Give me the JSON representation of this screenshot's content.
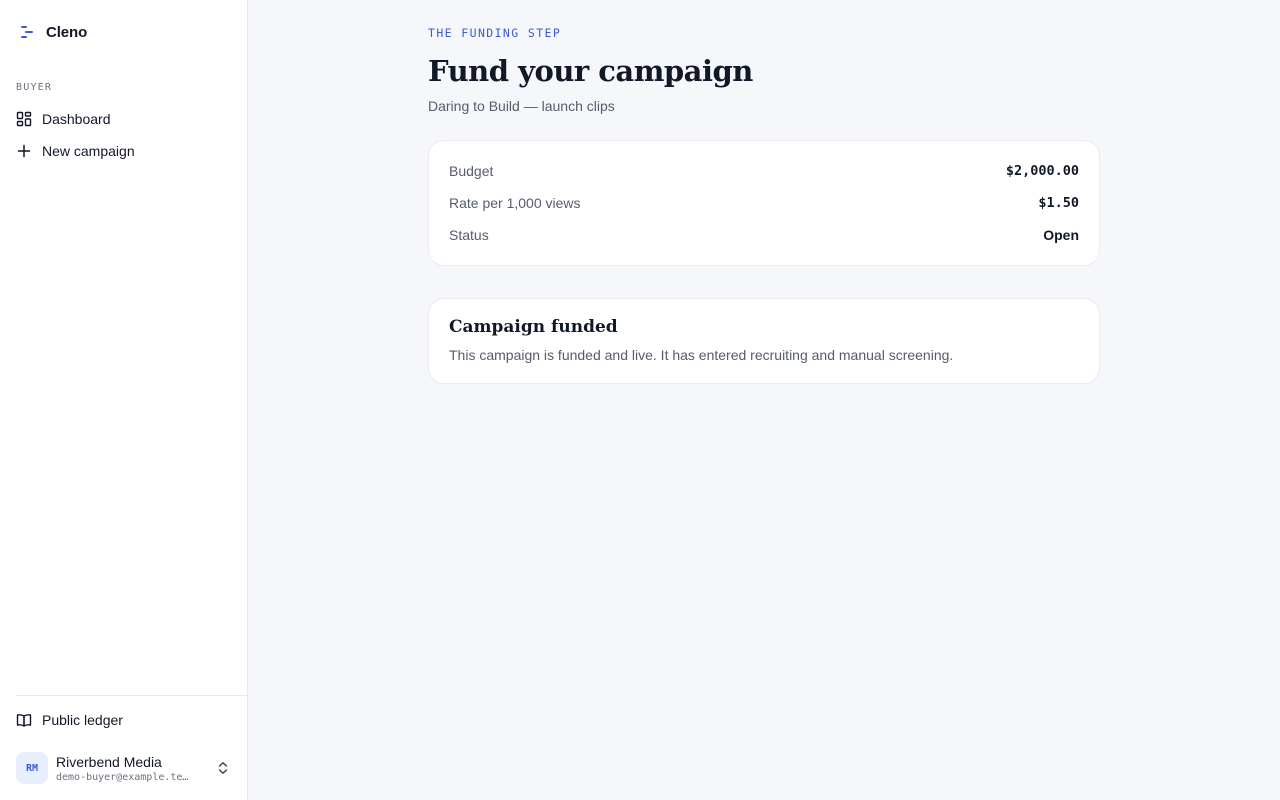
{
  "brand": {
    "name": "Cleno",
    "icon": "list-indent-icon",
    "accent": "#3b5bd6"
  },
  "sidebar": {
    "section_label": "BUYER",
    "items": [
      {
        "label": "Dashboard",
        "icon": "grid-layout-icon"
      },
      {
        "label": "New campaign",
        "icon": "plus-icon"
      }
    ],
    "ledger": {
      "label": "Public ledger",
      "icon": "book-open-icon"
    },
    "account": {
      "initials": "RM",
      "name": "Riverbend Media",
      "email": "demo-buyer@example.te…",
      "icon": "chevron-up-down-icon"
    }
  },
  "main": {
    "eyebrow": "THE FUNDING STEP",
    "title": "Fund your campaign",
    "subtitle": "Daring to Build — launch clips",
    "summary": [
      {
        "label": "Budget",
        "value": "$2,000.00"
      },
      {
        "label": "Rate per 1,000 views",
        "value": "$1.50"
      },
      {
        "label": "Status",
        "value": "Open"
      }
    ],
    "notice": {
      "title": "Campaign funded",
      "body": "This campaign is funded and live. It has entered recruiting and manual screening."
    }
  }
}
